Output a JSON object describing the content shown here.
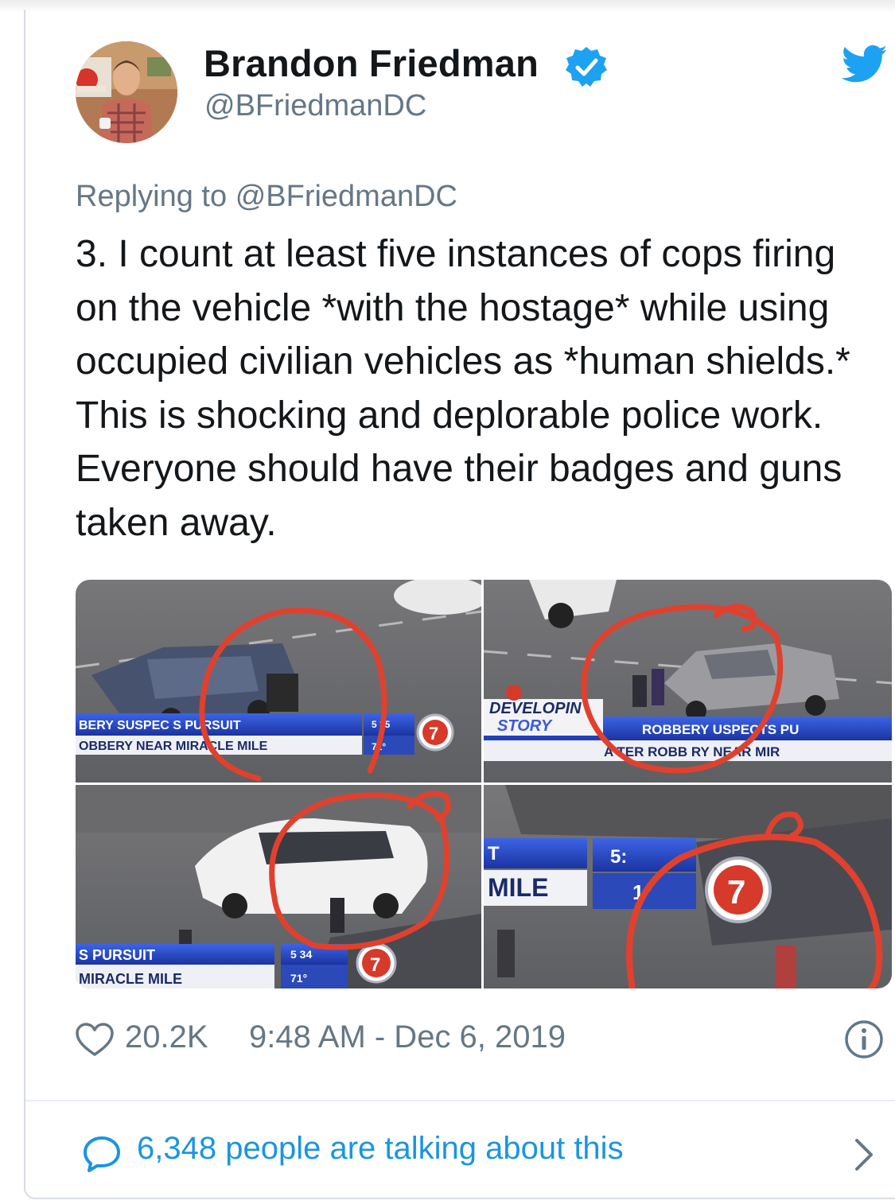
{
  "tweet": {
    "author_name": "Brandon Friedman",
    "author_handle": "@BFriedmanDC",
    "replying_prefix": "Replying to",
    "replying_handle": "@BFriedmanDC",
    "text_lines": [
      "3. I count at least five instances of cops firing",
      "on the vehicle *with the hostage* while using",
      "occupied civilian vehicles as *human shields.*",
      "This is shocking and deplorable police work.",
      "Everyone should have their badges and guns",
      "taken away."
    ],
    "likes": "20.2K",
    "timestamp": "9:48 AM - Dec 6, 2019",
    "conversation": "6,348 people are talking about this"
  },
  "media": {
    "panels": [
      {
        "ticker_top": "BERY SUSPEC  S PURSUIT",
        "ticker_bottom": "OBBERY NEAR MIRACLE MILE",
        "clock": "5 35",
        "temp": "71°"
      },
      {
        "bug_top": "DEVELOPIN",
        "bug_bottom": "STORY",
        "ticker_top": "ROBBERY  USPECTS PU",
        "ticker_bottom": "A  TER ROBB  RY NEAR MIR"
      },
      {
        "ticker_top": "S PURSUIT",
        "ticker_bottom": "MIRACLE MILE",
        "clock": "5 34",
        "temp": "71°"
      },
      {
        "ticker_top": "T",
        "ticker_bottom": "MILE",
        "clock": "5:",
        "temp": "1°"
      }
    ],
    "channel_number": "7"
  },
  "icons": {
    "verified": "verified-badge-icon",
    "bird": "twitter-bird-icon",
    "heart": "heart-icon",
    "info": "info-icon",
    "bubble": "comment-bubble-icon",
    "chevron": "chevron-right-icon"
  },
  "colors": {
    "twitter_blue": "#1da1f2",
    "link_blue": "#1b95e0",
    "secondary_text": "#657786",
    "annotation_red": "#e0412e",
    "ticker_blue": "#1f47c4"
  }
}
